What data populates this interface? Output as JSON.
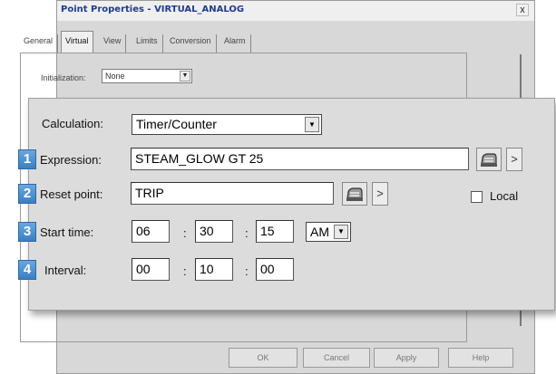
{
  "background_dialog": {
    "title": "Point Properties - VIRTUAL_ANALOG",
    "close_label": "x",
    "tabs": [
      {
        "label": "General"
      },
      {
        "label": "Virtual"
      },
      {
        "label": "View"
      },
      {
        "label": "Limits"
      },
      {
        "label": "Conversion"
      },
      {
        "label": "Alarm"
      }
    ],
    "initialization": {
      "label": "Initialization:",
      "value": "None"
    },
    "buttons": {
      "ok": "OK",
      "cancel": "Cancel",
      "apply": "Apply",
      "help": "Help"
    }
  },
  "panel": {
    "calculation": {
      "label": "Calculation:",
      "value": "Timer/Counter"
    },
    "rows": [
      {
        "number": "1",
        "label": "Expression:",
        "value": "STEAM_GLOW GT 25"
      },
      {
        "number": "2",
        "label": "Reset point:",
        "value": "TRIP"
      },
      {
        "number": "3",
        "label": "Start time:"
      },
      {
        "number": "4",
        "label": "Interval:"
      }
    ],
    "arrow_glyph": ">",
    "local_label": "Local",
    "start_time": {
      "hours": "06",
      "minutes": "30",
      "seconds": "15",
      "ampm": "AM"
    },
    "interval": {
      "hours": "00",
      "minutes": "10",
      "seconds": "00"
    },
    "time_separator": ":",
    "dropdown_glyph": "▼"
  },
  "colors": {
    "badge_blue": "#4a8ccf",
    "title_blue": "#1f3c8c"
  }
}
